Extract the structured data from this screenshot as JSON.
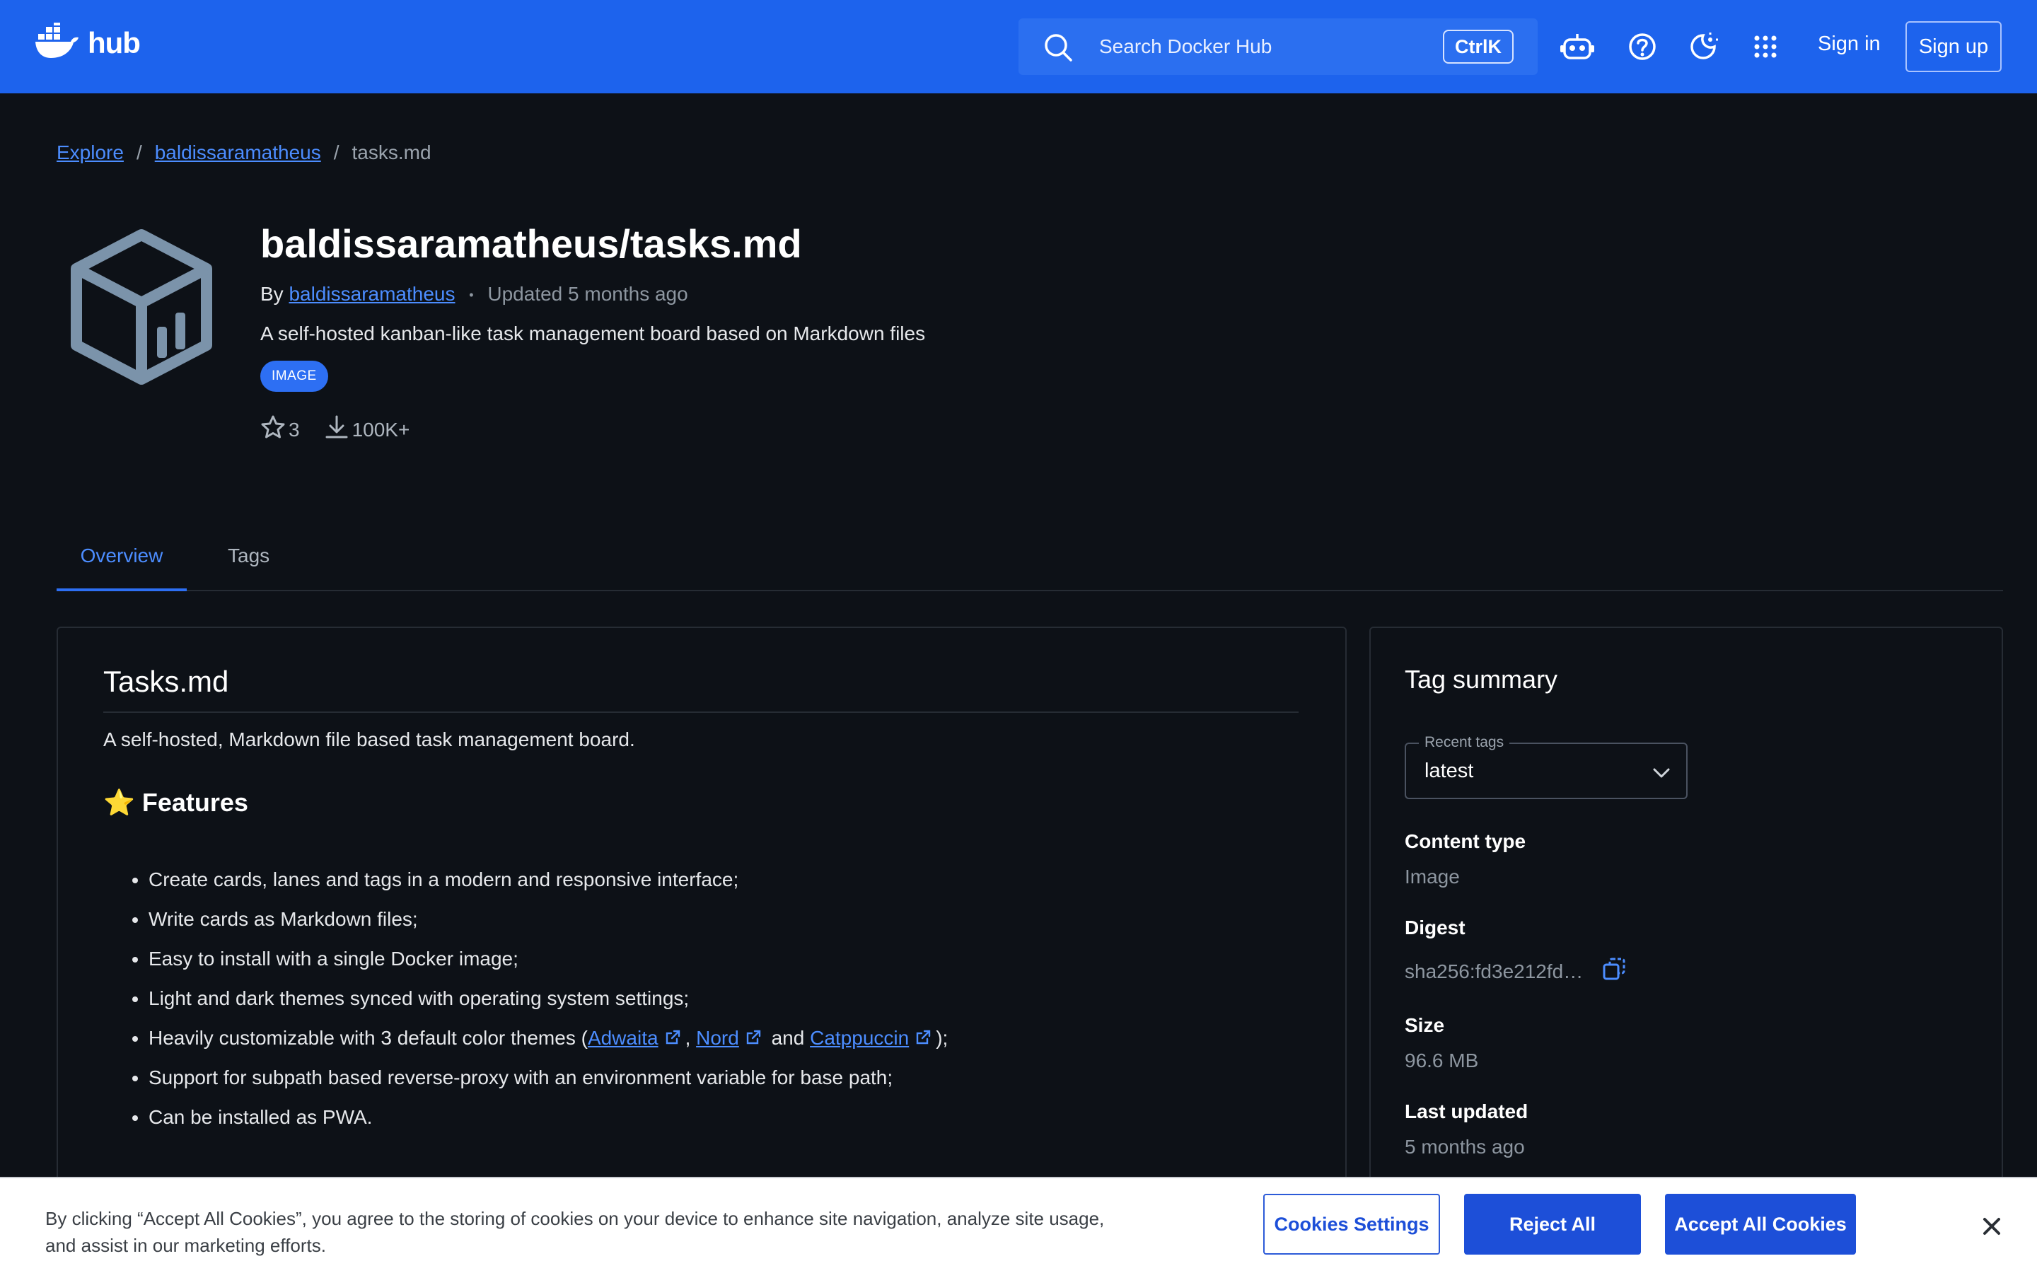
{
  "header": {
    "logo_text": "hub",
    "search_placeholder": "Search Docker Hub",
    "search_shortcut": "CtrlK",
    "sign_in": "Sign in",
    "sign_up": "Sign up",
    "brand_color": "#1d63ed"
  },
  "breadcrumb": {
    "items": [
      "Explore",
      "baldissaramatheus",
      "tasks.md"
    ],
    "separator": "/"
  },
  "repo": {
    "title": "baldissaramatheus/tasks.md",
    "by_prefix": "By",
    "author": "baldissaramatheus",
    "dot": "•",
    "updated": "Updated 5 months ago",
    "description": "A self-hosted kanban-like task management board based on Markdown files",
    "badge": "IMAGE",
    "stars": "3",
    "pulls": "100K+"
  },
  "tabs": [
    {
      "label": "Overview",
      "active": true
    },
    {
      "label": "Tags",
      "active": false
    }
  ],
  "readme": {
    "title": "Tasks.md",
    "intro": "A self-hosted, Markdown file based task management board.",
    "features_emoji": "⭐",
    "features_heading": "Features",
    "features": [
      "Create cards, lanes and tags in a modern and responsive interface;",
      "Write cards as Markdown files;",
      "Easy to install with a single Docker image;",
      "Light and dark themes synced with operating system settings;",
      "Support for subpath based reverse-proxy with an environment variable for base path;",
      "Can be installed as PWA."
    ],
    "themes_line": {
      "prefix": "Heavily customizable with 3 default color themes (",
      "link1": "Adwaita",
      "sep1": ",",
      "link2": "Nord",
      "sep2": "and",
      "link3": "Catppuccin",
      "suffix": ");"
    }
  },
  "tag_summary": {
    "heading": "Tag summary",
    "recent_tags_label": "Recent tags",
    "recent_tags_value": "latest",
    "content_type_label": "Content type",
    "content_type_value": "Image",
    "digest_label": "Digest",
    "digest_value": "sha256:fd3e212fd…",
    "size_label": "Size",
    "size_value": "96.6 MB",
    "last_updated_label": "Last updated",
    "last_updated_value": "5 months ago"
  },
  "cookie_banner": {
    "message": "By clicking “Accept All Cookies”, you agree to the storing of cookies on your device to enhance site navigation, analyze site usage, and assist in our marketing efforts.",
    "settings": "Cookies Settings",
    "reject": "Reject All",
    "accept": "Accept All Cookies"
  }
}
